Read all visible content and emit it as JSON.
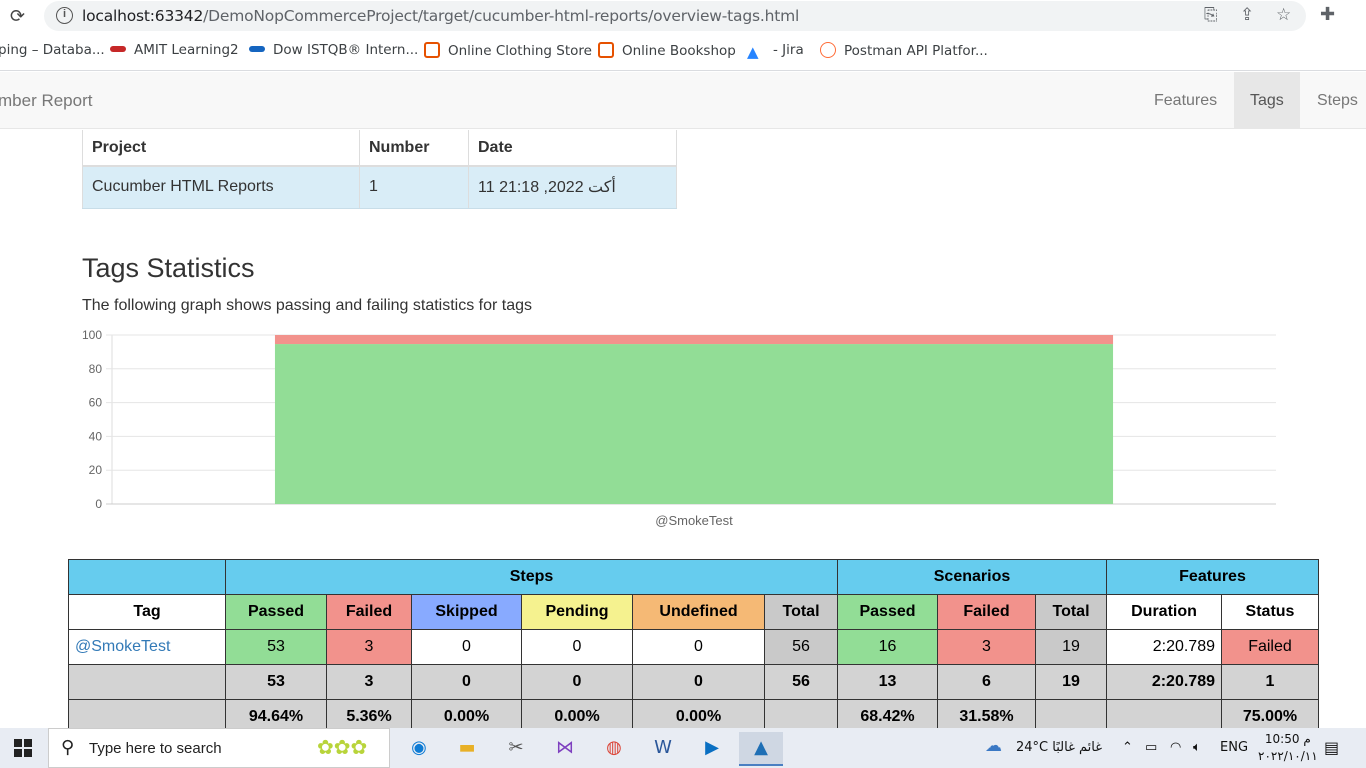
{
  "browser": {
    "url_host": "localhost:63342",
    "url_path": "/DemoNopCommerceProject/target/cucumber-html-reports/overview-tags.html",
    "bookmarks": [
      {
        "label": "ping – Databa...",
        "color": "#1a73e8"
      },
      {
        "label": "AMIT Learning2",
        "color": "#c62828"
      },
      {
        "label": "Dow ISTQB® Intern...",
        "color": "#1565c0"
      },
      {
        "label": "Online Clothing Store",
        "color": "#e65100"
      },
      {
        "label": "Online Bookshop",
        "color": "#e65100"
      },
      {
        "label": "- Jira",
        "color": "#2684ff"
      },
      {
        "label": "Postman API Platfor...",
        "color": "#ff6c37"
      }
    ]
  },
  "navbar": {
    "brand": "mber Report",
    "items": [
      "Features",
      "Tags",
      "Steps"
    ],
    "active": "Tags"
  },
  "project_table": {
    "headers": [
      "Project",
      "Number",
      "Date"
    ],
    "row": [
      "Cucumber HTML Reports",
      "1",
      "11 أكت 2022, 21:18"
    ]
  },
  "page": {
    "title": "Tags Statistics",
    "description": "The following graph shows passing and failing statistics for tags"
  },
  "chart_data": {
    "type": "bar",
    "stacked": true,
    "categories": [
      "@SmokeTest"
    ],
    "series": [
      {
        "name": "Passed",
        "values": [
          94.64
        ],
        "color": "#92dd96"
      },
      {
        "name": "Failed",
        "values": [
          5.36
        ],
        "color": "#f2928c"
      }
    ],
    "ylim": [
      0,
      100
    ],
    "yticks": [
      0,
      20,
      40,
      60,
      80,
      100
    ],
    "grid": true
  },
  "stats": {
    "group_headers": [
      "Steps",
      "Scenarios",
      "Features"
    ],
    "col_headers": [
      "Tag",
      "Passed",
      "Failed",
      "Skipped",
      "Pending",
      "Undefined",
      "Total",
      "Passed",
      "Failed",
      "Total",
      "Duration",
      "Status"
    ],
    "row": {
      "tag": "@SmokeTest",
      "cells": [
        "53",
        "3",
        "0",
        "0",
        "0",
        "56",
        "16",
        "3",
        "19",
        "2:20.789",
        "Failed"
      ]
    },
    "totals": [
      "",
      "53",
      "3",
      "0",
      "0",
      "0",
      "56",
      "13",
      "6",
      "19",
      "2:20.789",
      "1"
    ],
    "percents": [
      "",
      "94.64%",
      "5.36%",
      "0.00%",
      "0.00%",
      "0.00%",
      "",
      "68.42%",
      "31.58%",
      "",
      "",
      "75.00%"
    ]
  },
  "taskbar": {
    "search_placeholder": "Type here to search",
    "weather": "24°C  غائم غالبًا",
    "language": "ENG",
    "time": "10:50 م",
    "date": "٢٠٢٢/١٠/١١"
  }
}
